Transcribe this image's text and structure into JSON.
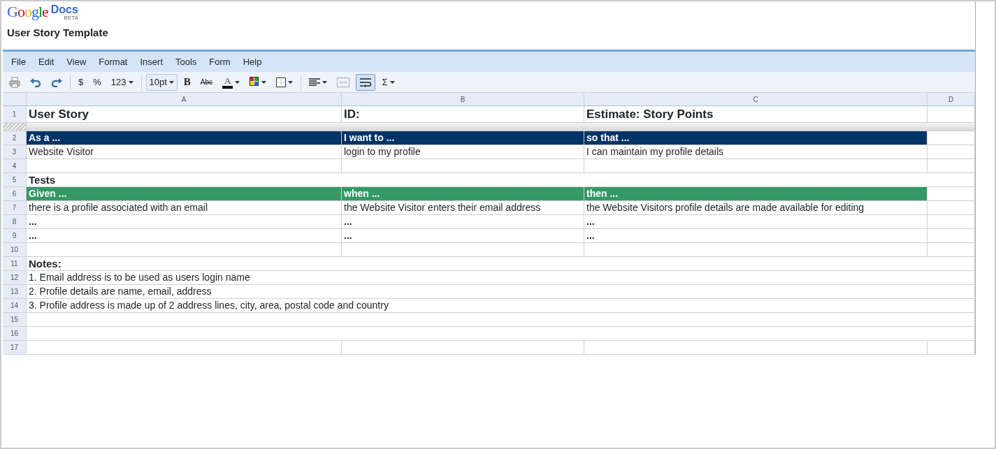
{
  "app": {
    "logo_word": "Google",
    "logo_product": "Docs",
    "logo_badge": "BETA"
  },
  "document_title": "User Story Template",
  "menu": [
    "File",
    "Edit",
    "View",
    "Format",
    "Insert",
    "Tools",
    "Form",
    "Help"
  ],
  "toolbar": [
    {
      "kind": "print",
      "on": false
    },
    {
      "kind": "undo",
      "on": false
    },
    {
      "kind": "redo",
      "on": false
    },
    {
      "kind": "separator"
    },
    {
      "kind": "text",
      "label": "$",
      "on": false
    },
    {
      "kind": "text",
      "label": "%",
      "on": false
    },
    {
      "kind": "menu",
      "label": "123",
      "on": false
    },
    {
      "kind": "separator"
    },
    {
      "kind": "select",
      "label": "10pt",
      "on": false
    },
    {
      "kind": "bold",
      "label": "B",
      "on": false
    },
    {
      "kind": "strike",
      "label": "Abc",
      "on": false
    },
    {
      "kind": "textcolor",
      "label": "A",
      "on": false
    },
    {
      "kind": "fillcolor",
      "on": false
    },
    {
      "kind": "borders",
      "on": false
    },
    {
      "kind": "separator"
    },
    {
      "kind": "align",
      "on": false
    },
    {
      "kind": "merge",
      "on": false
    },
    {
      "kind": "wrap",
      "on": true
    },
    {
      "kind": "menu",
      "label": "Σ",
      "on": false
    }
  ],
  "sheet": {
    "columns": [
      "A",
      "B",
      "C",
      "D"
    ],
    "rows": [
      {
        "number": "1",
        "kind": "title",
        "cells": [
          "User Story",
          "ID:",
          "Estimate: Story Points"
        ]
      },
      {
        "number": "2",
        "kind": "blue-header",
        "cells": [
          "As a ...",
          "I want to ...",
          "so that ..."
        ]
      },
      {
        "number": "3",
        "kind": "text",
        "cells": [
          "Website Visitor",
          "login to my profile",
          "I can maintain my profile details"
        ]
      },
      {
        "number": "4",
        "kind": "blank"
      },
      {
        "number": "5",
        "kind": "label",
        "cells": [
          "Tests"
        ]
      },
      {
        "number": "6",
        "kind": "green-header",
        "cells": [
          "Given ...",
          "when ...",
          "then ..."
        ]
      },
      {
        "number": "7",
        "kind": "text",
        "cells": [
          "there is a profile associated with an email",
          "the Website Visitor enters their email address",
          "the Website Visitors profile details are made available for editing"
        ]
      },
      {
        "number": "8",
        "kind": "bold",
        "cells": [
          "...",
          "...",
          "..."
        ]
      },
      {
        "number": "9",
        "kind": "bold",
        "cells": [
          "...",
          "...",
          "..."
        ]
      },
      {
        "number": "10",
        "kind": "blank"
      },
      {
        "number": "11",
        "kind": "label",
        "cells": [
          "Notes:"
        ]
      },
      {
        "number": "12",
        "kind": "note",
        "cells": [
          "1. Email address is to be used as users login name"
        ]
      },
      {
        "number": "13",
        "kind": "note",
        "cells": [
          "2. Profile details are name, email, address"
        ]
      },
      {
        "number": "14",
        "kind": "note",
        "cells": [
          "3. Profile address is made up of 2 address lines, city, area, postal code and country"
        ]
      },
      {
        "number": "15",
        "kind": "open"
      },
      {
        "number": "16",
        "kind": "open"
      },
      {
        "number": "17",
        "kind": "blank"
      }
    ]
  }
}
